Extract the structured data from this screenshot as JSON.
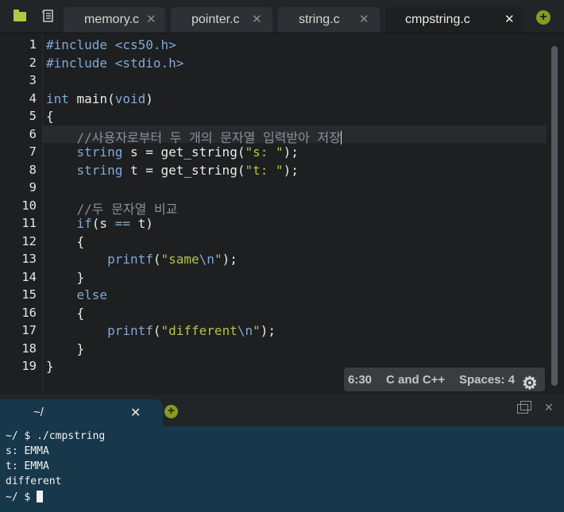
{
  "tabs": [
    {
      "label": "memory.c",
      "active": false
    },
    {
      "label": "pointer.c",
      "active": false
    },
    {
      "label": "string.c",
      "active": false
    },
    {
      "label": "cmpstring.c",
      "active": true
    }
  ],
  "tab_close_symbol": "✕",
  "add_symbol": "+",
  "editor": {
    "current_line": 6,
    "line_numbers": [
      "1",
      "2",
      "3",
      "4",
      "5",
      "6",
      "7",
      "8",
      "9",
      "10",
      "11",
      "12",
      "13",
      "14",
      "15",
      "16",
      "17",
      "18",
      "19"
    ],
    "lines": [
      [
        {
          "t": "#include <cs50.h>",
          "c": "kw"
        }
      ],
      [
        {
          "t": "#include <stdio.h>",
          "c": "kw"
        }
      ],
      [],
      [
        {
          "t": "int",
          "c": "kw"
        },
        {
          "t": " main(",
          "c": ""
        },
        {
          "t": "void",
          "c": "kw"
        },
        {
          "t": ")",
          "c": ""
        }
      ],
      [
        {
          "t": "{",
          "c": ""
        }
      ],
      [
        {
          "t": "    //사용자로부터 두 개의 문자열 입력받아 저장",
          "c": "cmt"
        }
      ],
      [
        {
          "t": "    ",
          "c": ""
        },
        {
          "t": "string",
          "c": "kw"
        },
        {
          "t": " s = get_string(",
          "c": ""
        },
        {
          "t": "\"s: \"",
          "c": "str"
        },
        {
          "t": ");",
          "c": ""
        }
      ],
      [
        {
          "t": "    ",
          "c": ""
        },
        {
          "t": "string",
          "c": "kw"
        },
        {
          "t": " t = get_string(",
          "c": ""
        },
        {
          "t": "\"t: \"",
          "c": "str"
        },
        {
          "t": ");",
          "c": ""
        }
      ],
      [],
      [
        {
          "t": "    //두 문자열 비교",
          "c": "cmt"
        }
      ],
      [
        {
          "t": "    ",
          "c": ""
        },
        {
          "t": "if",
          "c": "kw"
        },
        {
          "t": "(s ",
          "c": ""
        },
        {
          "t": "==",
          "c": "kw"
        },
        {
          "t": " t)",
          "c": ""
        }
      ],
      [
        {
          "t": "    {",
          "c": ""
        }
      ],
      [
        {
          "t": "        ",
          "c": ""
        },
        {
          "t": "printf",
          "c": "kw"
        },
        {
          "t": "(",
          "c": ""
        },
        {
          "t": "\"same",
          "c": "str"
        },
        {
          "t": "\\n",
          "c": "kw"
        },
        {
          "t": "\"",
          "c": "str"
        },
        {
          "t": ");",
          "c": ""
        }
      ],
      [
        {
          "t": "    }",
          "c": ""
        }
      ],
      [
        {
          "t": "    ",
          "c": ""
        },
        {
          "t": "else",
          "c": "kw"
        }
      ],
      [
        {
          "t": "    {",
          "c": ""
        }
      ],
      [
        {
          "t": "        ",
          "c": ""
        },
        {
          "t": "printf",
          "c": "kw"
        },
        {
          "t": "(",
          "c": ""
        },
        {
          "t": "\"different",
          "c": "str"
        },
        {
          "t": "\\n",
          "c": "kw"
        },
        {
          "t": "\"",
          "c": "str"
        },
        {
          "t": ");",
          "c": ""
        }
      ],
      [
        {
          "t": "    }",
          "c": ""
        }
      ],
      [
        {
          "t": "}",
          "c": ""
        }
      ]
    ]
  },
  "status": {
    "cursor_position": "6:30",
    "language": "C and C++",
    "indentation": "Spaces: 4"
  },
  "terminal": {
    "tab_label": "~/",
    "lines": [
      "~/ $ ./cmpstring",
      "s: EMMA",
      "t: EMMA",
      "different"
    ],
    "prompt": "~/ $ "
  },
  "colors": {
    "keyword": "#82a8d6",
    "string": "#b5c24a",
    "comment": "#8b919a",
    "accent_add": "#8a9a22",
    "terminal_bg": "#17374b"
  }
}
